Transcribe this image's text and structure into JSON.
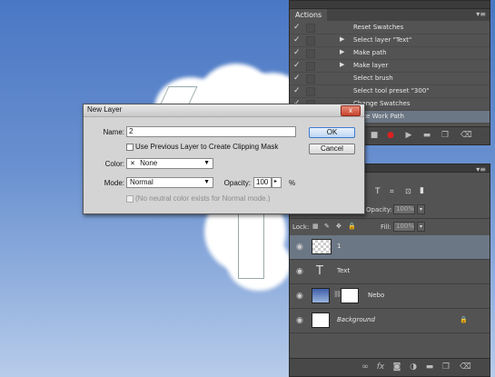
{
  "actions_panel": {
    "tab": "Actions",
    "rows": [
      {
        "label": "Reset Swatches",
        "expand": false,
        "selected": false
      },
      {
        "label": "Select layer \"Text\"",
        "expand": true,
        "selected": false
      },
      {
        "label": "Make path",
        "expand": true,
        "selected": false
      },
      {
        "label": "Make layer",
        "expand": true,
        "selected": false
      },
      {
        "label": "Select brush",
        "expand": false,
        "selected": false
      },
      {
        "label": "Select tool preset \"300\"",
        "expand": false,
        "selected": false
      },
      {
        "label": "Change Swatches",
        "expand": false,
        "selected": false
      },
      {
        "label": "Make Work Path",
        "expand": false,
        "selected": true
      }
    ]
  },
  "layers_panel": {
    "opacity_label": "Opacity:",
    "opacity_value": "100%",
    "lock_label": "Lock:",
    "fill_label": "Fill:",
    "fill_value": "100%",
    "layers": [
      {
        "name": "1",
        "kind": "transparent",
        "selected": true
      },
      {
        "name": "Text",
        "kind": "text",
        "selected": false
      },
      {
        "name": "Nebo",
        "kind": "image-mask",
        "selected": false
      },
      {
        "name": "Background",
        "kind": "white",
        "selected": false,
        "italic": true
      }
    ]
  },
  "dialog": {
    "title": "New Layer",
    "close": "x",
    "name_label": "Name:",
    "name_value": "2",
    "clip_label": "Use Previous Layer to Create Clipping Mask",
    "color_label": "Color:",
    "color_value": "None",
    "mode_label": "Mode:",
    "mode_value": "Normal",
    "opacity_label": "Opacity:",
    "opacity_value": "100",
    "opacity_unit": "%",
    "neutral_label": "(No neutral color exists for Normal mode.)",
    "ok_label": "OK",
    "cancel_label": "Cancel"
  }
}
